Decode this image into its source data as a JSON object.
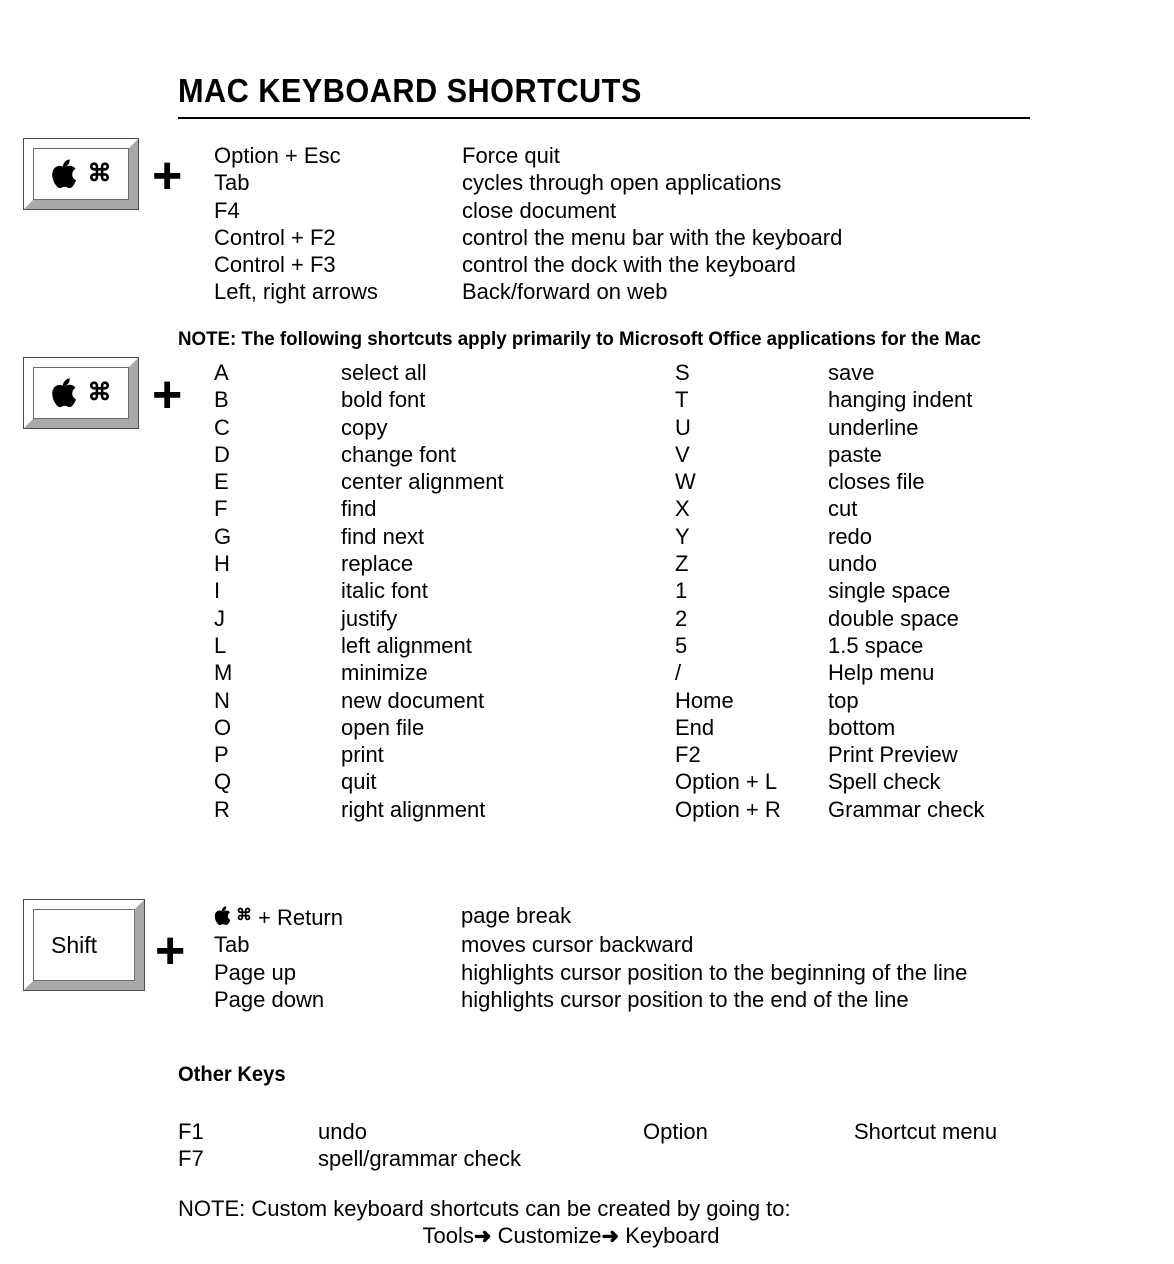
{
  "document": {
    "title": "MAC KEYBOARD SHORTCUTS"
  },
  "icons": {
    "apple": "apple-logo-icon",
    "command": "⌘",
    "plus": "+",
    "arrow": "➜"
  },
  "sections": [
    {
      "id": "command-system",
      "key_label": "",
      "key_glyphs": [
        "apple-logo-icon",
        "⌘"
      ],
      "plus": "+",
      "rows": [
        {
          "key": "Option + Esc",
          "desc": "Force quit"
        },
        {
          "key": "Tab",
          "desc": "cycles through open applications"
        },
        {
          "key": "F4",
          "desc": "close document"
        },
        {
          "key": "Control + F2",
          "desc": "control the menu bar with the keyboard"
        },
        {
          "key": "Control + F3",
          "desc": "control the dock with the keyboard"
        },
        {
          "key": "Left, right arrows",
          "desc": "Back/forward on web"
        }
      ]
    }
  ],
  "note_office": "NOTE: The following shortcuts apply primarily to Microsoft Office applications for the Mac",
  "office_section": {
    "key_glyphs": [
      "apple-logo-icon",
      "⌘"
    ],
    "plus": "+",
    "left_column": [
      {
        "key": "A",
        "desc": "select all"
      },
      {
        "key": "B",
        "desc": "bold font"
      },
      {
        "key": "C",
        "desc": "copy"
      },
      {
        "key": "D",
        "desc": "change font"
      },
      {
        "key": "E",
        "desc": "center alignment"
      },
      {
        "key": "F",
        "desc": "find"
      },
      {
        "key": "G",
        "desc": "find next"
      },
      {
        "key": "H",
        "desc": "replace"
      },
      {
        "key": "I",
        "desc": "italic font"
      },
      {
        "key": "J",
        "desc": "justify"
      },
      {
        "key": "L",
        "desc": "left alignment"
      },
      {
        "key": "M",
        "desc": "minimize"
      },
      {
        "key": "N",
        "desc": "new document"
      },
      {
        "key": "O",
        "desc": "open file"
      },
      {
        "key": "P",
        "desc": "print"
      },
      {
        "key": "Q",
        "desc": "quit"
      },
      {
        "key": "R",
        "desc": "right alignment"
      }
    ],
    "right_column": [
      {
        "key": "S",
        "desc": "save"
      },
      {
        "key": "T",
        "desc": "hanging indent"
      },
      {
        "key": "U",
        "desc": "underline"
      },
      {
        "key": "V",
        "desc": "paste"
      },
      {
        "key": "W",
        "desc": "closes file"
      },
      {
        "key": "X",
        "desc": "cut"
      },
      {
        "key": "Y",
        "desc": "redo"
      },
      {
        "key": "Z",
        "desc": "undo"
      },
      {
        "key": "1",
        "desc": "single space"
      },
      {
        "key": "2",
        "desc": "double space"
      },
      {
        "key": "5",
        "desc": "1.5 space"
      },
      {
        "key": "/",
        "desc": "Help menu"
      },
      {
        "key": "Home",
        "desc": "top"
      },
      {
        "key": "End",
        "desc": "bottom"
      },
      {
        "key": "F2",
        "desc": "Print Preview"
      },
      {
        "key": "Option + L",
        "desc": "Spell check"
      },
      {
        "key": "Option + R",
        "desc": "Grammar check"
      }
    ]
  },
  "shift_section": {
    "key_label": "Shift",
    "plus": "+",
    "rows": [
      {
        "key": "+ Return",
        "key_prefix_glyphs": [
          "apple-logo-icon",
          "⌘"
        ],
        "desc": "page break"
      },
      {
        "key": "Tab",
        "desc": "moves cursor backward"
      },
      {
        "key": "Page up",
        "desc": "highlights cursor position to the beginning of the line"
      },
      {
        "key": "Page down",
        "desc": "highlights cursor position to the end of the line"
      }
    ]
  },
  "other_keys": {
    "heading": "Other Keys",
    "rows": [
      {
        "key": "F1",
        "desc": "undo",
        "key2": "Option",
        "desc2": "Shortcut menu"
      },
      {
        "key": "F7",
        "desc": "spell/grammar check",
        "key2": "",
        "desc2": ""
      }
    ]
  },
  "note_custom": {
    "line1": "NOTE: Custom keyboard shortcuts can be created by going to:",
    "line2_part1": "Tools",
    "line2_arrow1": "➜",
    "line2_part2": " Customize",
    "line2_arrow2": "➜",
    "line2_part3": " Keyboard"
  }
}
